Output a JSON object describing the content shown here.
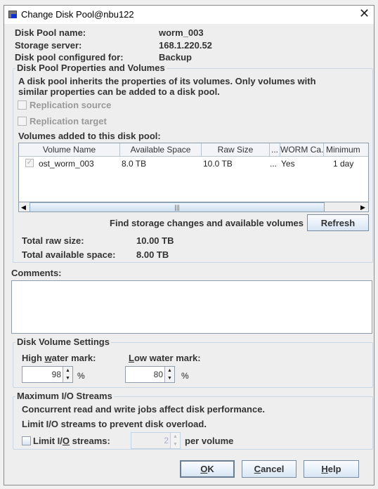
{
  "window": {
    "title": "Change Disk Pool@nbu122",
    "icon": "app-window-icon",
    "close_icon": "close-icon"
  },
  "info": {
    "pool_name_label": "Disk Pool name:",
    "pool_name": "worm_003",
    "server_label": "Storage server:",
    "server": "168.1.220.52",
    "configured_label": "Disk pool configured for:",
    "configured": "Backup"
  },
  "properties": {
    "title": "Disk Pool Properties and Volumes",
    "desc1": "A disk pool inherits the properties of its volumes. Only volumes with",
    "desc2": "similar properties can be added to a disk pool.",
    "replication_source": "Replication source",
    "replication_target": "Replication target",
    "volumes_label": "Volumes added to this disk pool:",
    "columns": [
      "Volume Name",
      "Available Space",
      "Raw Size",
      "...",
      "WORM Ca...",
      "Minimum"
    ],
    "rows": [
      {
        "checked": true,
        "name": "ost_worm_003",
        "available": "8.0 TB",
        "raw": "10.0 TB",
        "col4": "...",
        "worm": "Yes",
        "minimum": "1 day"
      }
    ],
    "find_label": "Find storage changes and available volumes",
    "refresh": "Refresh",
    "total_raw_label": "Total raw size:",
    "total_raw": "10.00 TB",
    "total_avail_label": "Total available space:",
    "total_avail": "8.00 TB"
  },
  "comments": {
    "label": "Comments:",
    "value": ""
  },
  "disk_volume": {
    "title": "Disk Volume Settings",
    "high_label_pre": "High ",
    "high_label_u": "w",
    "high_label_post": "ater mark:",
    "high_value": "98",
    "low_label_u": "L",
    "low_label_post": "ow water mark:",
    "low_value": "80",
    "unit": "%"
  },
  "io": {
    "title": "Maximum I/O Streams",
    "line1": "Concurrent read and write jobs affect disk performance.",
    "line2": "Limit I/O streams to prevent disk overload.",
    "limit_pre": "Limit I/",
    "limit_u": "O",
    "limit_post": " streams:",
    "limit_checked": false,
    "limit_value": "2",
    "per_volume": "per volume"
  },
  "buttons": {
    "ok_u": "O",
    "ok_rest": "K",
    "cancel_u": "C",
    "cancel_rest": "ancel",
    "help_u": "H",
    "help_rest": "elp"
  }
}
